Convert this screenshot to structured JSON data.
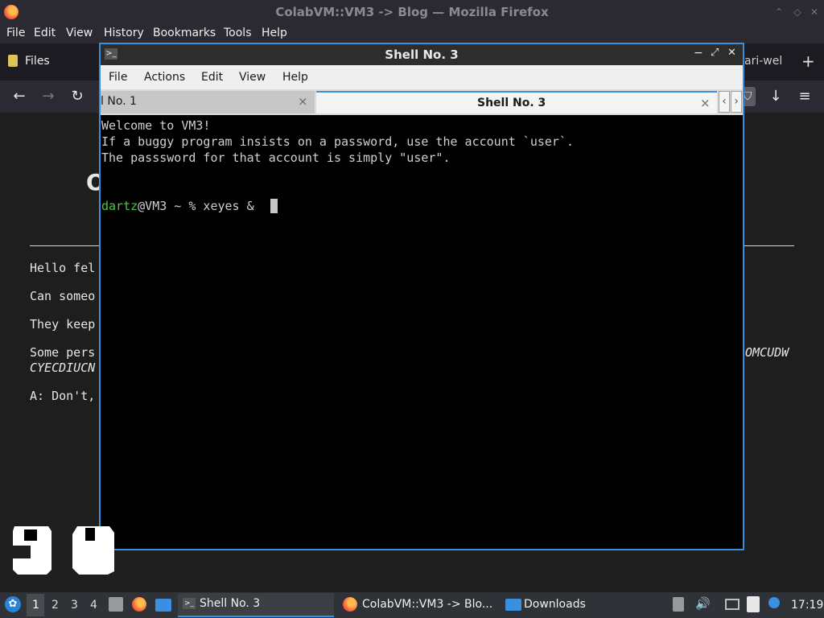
{
  "firefox": {
    "window_title": "ColabVM::VM3 -> Blog — Mozilla Firefox",
    "menu": [
      "File",
      "Edit",
      "View",
      "History",
      "Bookmarks",
      "Tools",
      "Help"
    ],
    "bookmark_files": "Files",
    "tab_fragment": "ari-wel",
    "new_tab": "+",
    "icons": {
      "back": "←",
      "forward": "→",
      "reload": "↻",
      "extensions": "⊕",
      "downloads": "↓",
      "menu": "≡",
      "minimize": "⌃",
      "restore": "⌃",
      "close": "✕"
    }
  },
  "page": {
    "heading_fragment": "O",
    "lines": [
      "Hello fel",
      "Can someo",
      "They keep",
      "Some pers",
      "CYECDIUCN",
      "A: Don't,"
    ],
    "right_fragment": "OMCUDW"
  },
  "terminal": {
    "title": "Shell No. 3",
    "menu": [
      "File",
      "Actions",
      "Edit",
      "View",
      "Help"
    ],
    "tabs": [
      {
        "label": "l No. 1",
        "close": "×"
      },
      {
        "label": "Shell No. 3",
        "close": "×"
      }
    ],
    "scroll_left": "‹",
    "scroll_right": "›",
    "lines": [
      "Welcome to VM3!",
      "If a buggy program insists on a password, use the account `user`.",
      "The passsword for that account is simply \"user\"."
    ],
    "prompt_user": "dartz",
    "prompt_rest": "@VM3 ~ % xeyes &",
    "buttons": {
      "minimize": "−",
      "maximize": "⤢",
      "close": "✕"
    }
  },
  "taskbar": {
    "workspaces": [
      "1",
      "2",
      "3",
      "4"
    ],
    "tasks": [
      {
        "label": "Shell No. 3"
      },
      {
        "label": "ColabVM::VM3 -> Blo..."
      },
      {
        "label": "Downloads"
      }
    ],
    "clock": "17:19"
  },
  "colors": {
    "accent": "#3b8ed9",
    "prompt_green": "#4ec24e"
  }
}
